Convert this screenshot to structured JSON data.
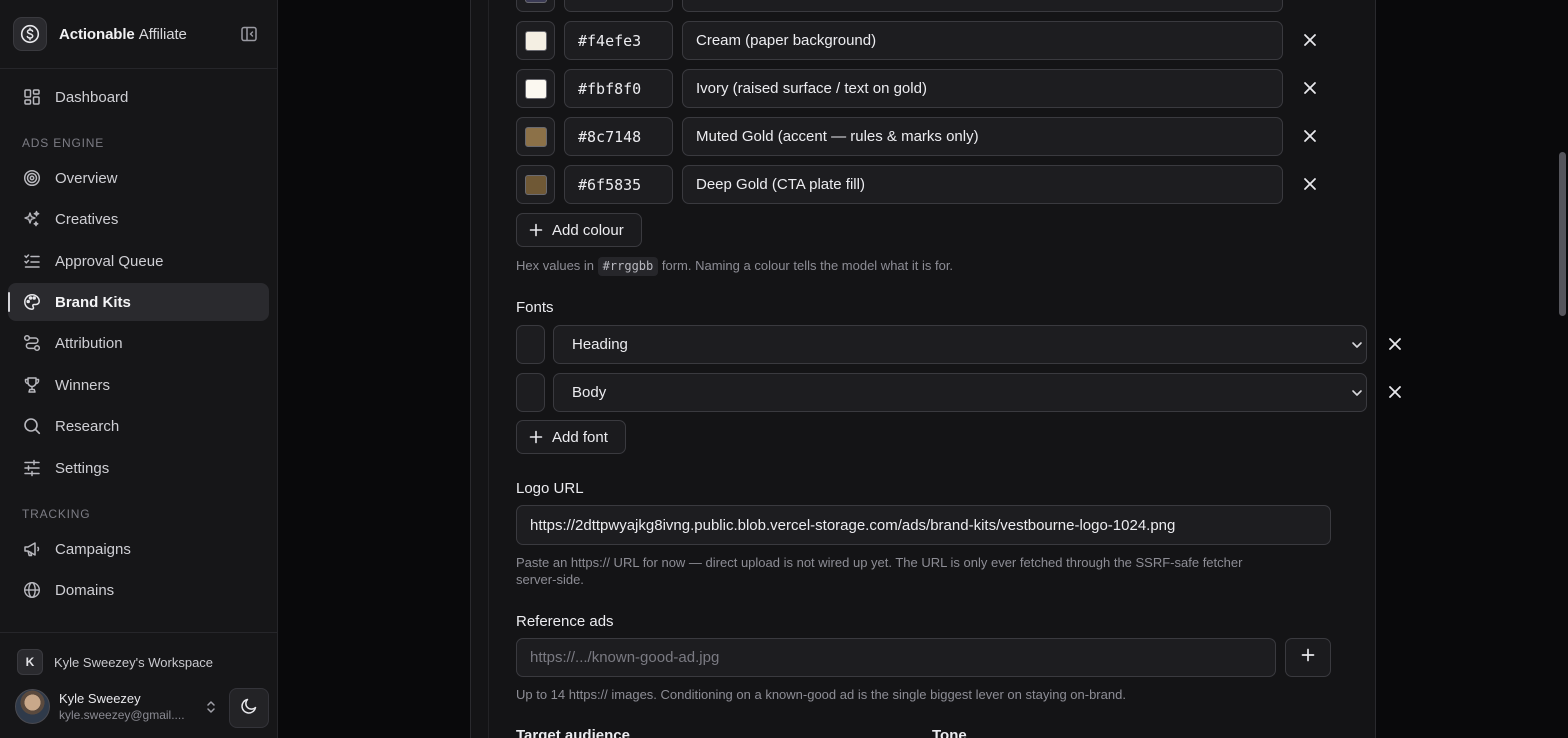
{
  "app": {
    "name_bold": "Actionable",
    "name_light": "Affiliate"
  },
  "sidebar": {
    "dashboard": "Dashboard",
    "section_ads": "ADS ENGINE",
    "ads_items": [
      {
        "label": "Overview",
        "icon": "target-icon"
      },
      {
        "label": "Creatives",
        "icon": "sparkles-icon"
      },
      {
        "label": "Approval Queue",
        "icon": "list-check-icon"
      },
      {
        "label": "Brand Kits",
        "icon": "palette-icon",
        "active": true
      },
      {
        "label": "Attribution",
        "icon": "route-icon"
      },
      {
        "label": "Winners",
        "icon": "trophy-icon"
      },
      {
        "label": "Research",
        "icon": "search-icon"
      },
      {
        "label": "Settings",
        "icon": "sliders-icon"
      }
    ],
    "section_tracking": "TRACKING",
    "tracking_items": [
      {
        "label": "Campaigns",
        "icon": "megaphone-icon"
      },
      {
        "label": "Domains",
        "icon": "globe-icon"
      }
    ],
    "workspace": {
      "badge": "K",
      "name": "Kyle Sweezey's Workspace"
    },
    "user": {
      "name": "Kyle Sweezey",
      "email": "kyle.sweezey@gmail...."
    }
  },
  "colours": [
    {
      "hex": "#f4efe3",
      "name": "Cream (paper background)",
      "swatch": "#f4efe3"
    },
    {
      "hex": "#fbf8f0",
      "name": "Ivory (raised surface / text on gold)",
      "swatch": "#fbf8f0"
    },
    {
      "hex": "#8c7148",
      "name": "Muted Gold (accent — rules & marks only)",
      "swatch": "#8c7148"
    },
    {
      "hex": "#6f5835",
      "name": "Deep Gold (CTA plate fill)",
      "swatch": "#6f5835"
    }
  ],
  "colours_section": {
    "add_label": "Add colour",
    "help_before": "Hex values in",
    "help_code": "#rrggbb",
    "help_after": "form. Naming a colour tells the model what it is for."
  },
  "fonts_section": {
    "label": "Fonts",
    "items": [
      "Heading",
      "Body"
    ],
    "add_label": "Add font"
  },
  "logo": {
    "label": "Logo URL",
    "value": "https://2dttpwyajkg8ivng.public.blob.vercel-storage.com/ads/brand-kits/vestbourne-logo-1024.png",
    "help_line1": "Paste an https:// URL for now — direct upload is not wired up yet. The URL is only ever fetched through the SSRF-safe fetcher",
    "help_line2": "server-side."
  },
  "reference_ads": {
    "label": "Reference ads",
    "placeholder": "https://.../known-good-ad.jpg",
    "help": "Up to 14 https:// images. Conditioning on a known-good ad is the single biggest lever on staying on-brand."
  },
  "bottom_labels": {
    "target_audience": "Target audience",
    "tone": "Tone"
  }
}
